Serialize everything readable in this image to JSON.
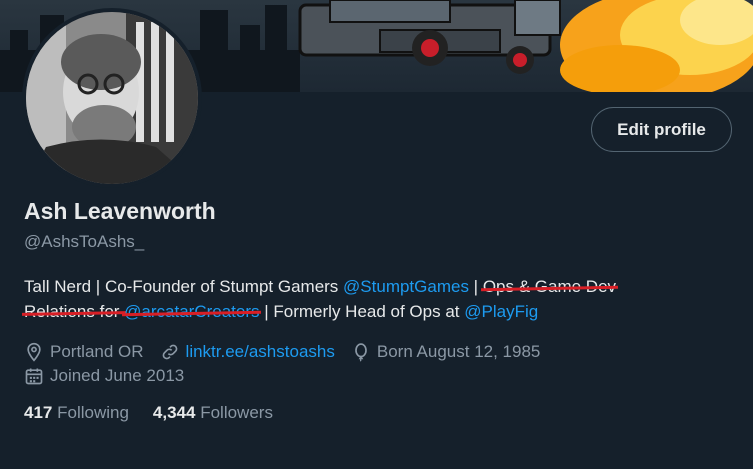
{
  "banner": {
    "description_icon": "banner-image"
  },
  "profile": {
    "name": "Ash Leavenworth",
    "handle": "@AshsToAshs_",
    "edit_label": "Edit profile"
  },
  "bio": {
    "part1": "Tall Nerd | Co-Founder of Stumpt Gamers ",
    "mention1": "@StumptGames",
    "sep1": " | ",
    "strike1": "Ops & Game Dev",
    "strike2": "Relations for ",
    "mention_struck": "@arcatarCreators",
    "part2": " | Formerly Head of Ops at ",
    "mention2": "@PlayFig"
  },
  "meta": {
    "location": "Portland OR",
    "website": "linktr.ee/ashstoashs",
    "birthday": "Born August 12, 1985",
    "joined": "Joined June 2013"
  },
  "stats": {
    "following_count": "417",
    "following_label": "Following",
    "followers_count": "4,344",
    "followers_label": "Followers"
  },
  "colors": {
    "background": "#15202b",
    "accent": "#1d9bf0",
    "secondary_text": "#8b98a5",
    "strike": "#d81f26"
  }
}
